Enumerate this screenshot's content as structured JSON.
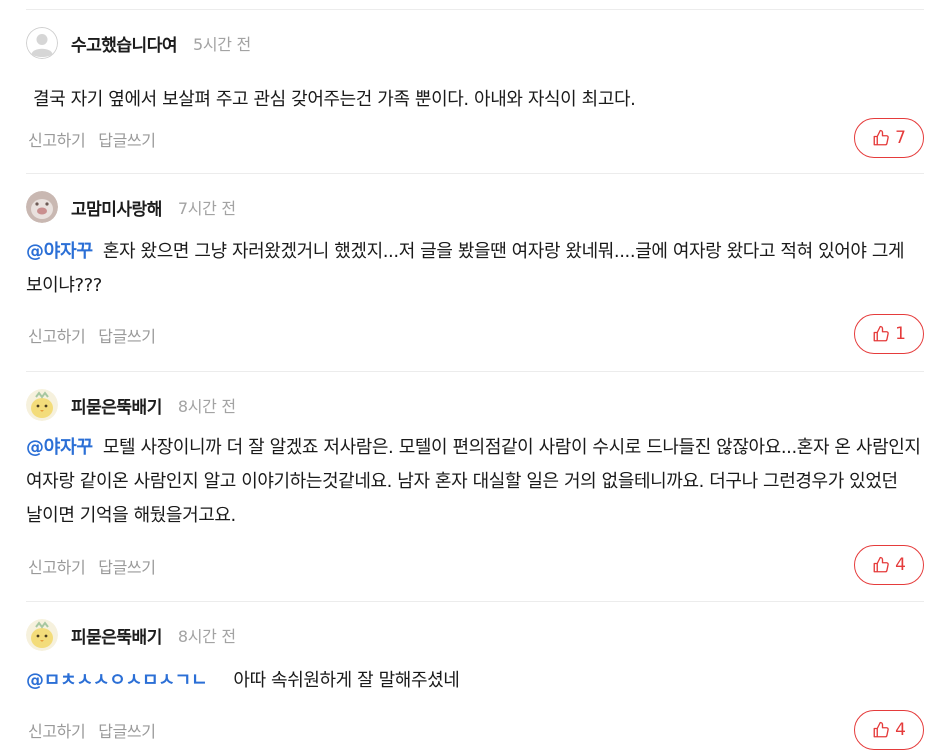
{
  "comments": [
    {
      "nickname": "수고했습니다여",
      "time": "5시간 전",
      "mention": "",
      "text": "결국 자기 옆에서 보살펴 주고 관심 갖어주는건 가족 뿐이다. 아내와 자식이 최고다.",
      "report_label": "신고하기",
      "reply_label": "답글쓰기",
      "likes": "7",
      "avatar_icon": "default-profile-icon"
    },
    {
      "nickname": "고맘미사랑해",
      "time": "7시간 전",
      "mention": "@야자꾸",
      "text": "혼자 왔으면 그냥 자러왔겠거니 했겠지...저 글을 봤을땐 여자랑 왔네뭐....글에 여자랑 왔다고 적혀 있어야 그게 보이냐???",
      "report_label": "신고하기",
      "reply_label": "답글쓰기",
      "likes": "1",
      "avatar_icon": "animal-profile-icon"
    },
    {
      "nickname": "피묻은뚝배기",
      "time": "8시간 전",
      "mention": "@야자꾸",
      "text": "모텔 사장이니까 더 잘 알겠죠 저사람은. 모텔이 편의점같이 사람이 수시로 드나들진 않잖아요...혼자 온 사람인지 여자랑 같이온 사람인지 알고 이야기하는것같네요. 남자 혼자 대실할 일은 거의 없을테니까요. 더구나 그런경우가 있었던 날이면 기억을 해뒀을거고요.",
      "report_label": "신고하기",
      "reply_label": "답글쓰기",
      "likes": "4",
      "avatar_icon": "chick-profile-icon"
    },
    {
      "nickname": "피묻은뚝배기",
      "time": "8시간 전",
      "mention": "@ㅁㅊㅅㅅㅇㅅㅁㅅㄱㄴ",
      "text": "아따 속쉬원하게 잘 말해주셨네",
      "report_label": "신고하기",
      "reply_label": "답글쓰기",
      "likes": "4",
      "avatar_icon": "chick-profile-icon"
    }
  ],
  "colors": {
    "accent_red": "#e53b3b",
    "mention_blue": "#2b6fd6",
    "muted_gray": "#9a9a9a"
  }
}
